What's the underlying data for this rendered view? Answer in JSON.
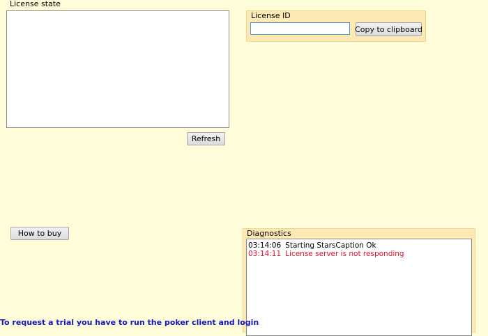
{
  "license_state": {
    "label": "License state",
    "refresh_label": "Refresh"
  },
  "license_id": {
    "label": "License ID",
    "value": "",
    "copy_label": "Copy to clipboard"
  },
  "how_to_buy_label": "How to buy",
  "diagnostics": {
    "label": "Diagnostics",
    "entries": [
      {
        "time": "03:14:06",
        "message": "Starting StarsCaption Ok",
        "color": "#000000"
      },
      {
        "time": "03:14:11",
        "message": "License server is not responding",
        "color": "#e0102a"
      }
    ]
  },
  "trial_text": "To request a trial you have to run the poker client and login"
}
